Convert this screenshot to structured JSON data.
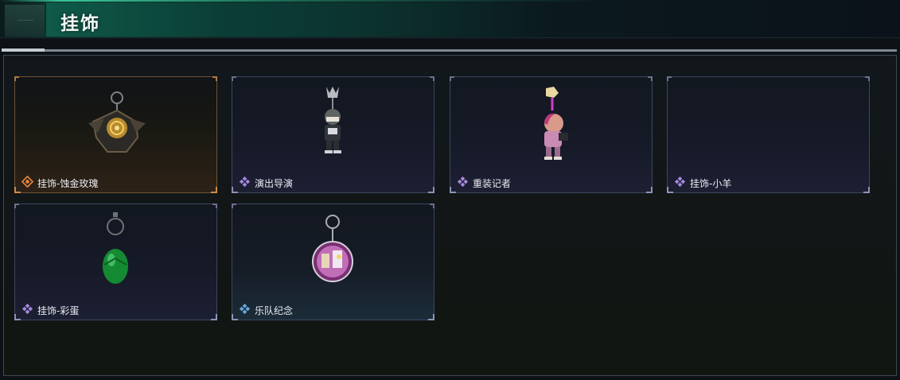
{
  "header": {
    "title": "挂饰"
  },
  "items": [
    {
      "name": "挂饰-蚀金玫瑰",
      "rarity": "legendary",
      "rarity_color": "#e8863a",
      "icon": "charm-gold-rose-icon"
    },
    {
      "name": "演出导演",
      "rarity": "epic",
      "rarity_color": "#a58ae0",
      "icon": "charm-director-figure-icon"
    },
    {
      "name": "重装记者",
      "rarity": "epic",
      "rarity_color": "#a58ae0",
      "icon": "charm-reporter-figure-icon"
    },
    {
      "name": "挂饰-小羊",
      "rarity": "epic",
      "rarity_color": "#a58ae0",
      "icon": ""
    },
    {
      "name": "挂饰-彩蛋",
      "rarity": "epic",
      "rarity_color": "#a58ae0",
      "icon": "charm-green-egg-icon"
    },
    {
      "name": "乐队纪念",
      "rarity": "rare",
      "rarity_color": "#6aa7e0",
      "icon": "charm-band-badge-icon"
    }
  ],
  "colors": {
    "accent": "#0f5a48",
    "legendary": "#e8863a",
    "epic": "#a58ae0",
    "rare": "#6aa7e0"
  }
}
